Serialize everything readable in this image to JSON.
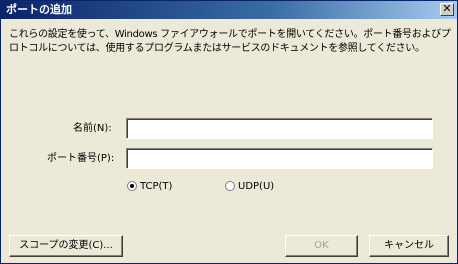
{
  "window": {
    "title": "ポートの追加",
    "close_glyph": "✕"
  },
  "description": {
    "line1": "これらの設定を使って、Windows ファイアウォールでポートを開いてください。ポート番号およびプ",
    "line2": "ロトコルについては、使用するプログラムまたはサービスのドキュメントを参照してください。"
  },
  "form": {
    "name_label": "名前(N):",
    "name_value": "",
    "port_label": "ポート番号(P):",
    "port_value": "",
    "protocol": {
      "tcp_label": "TCP(T)",
      "udp_label": "UDP(U)",
      "selected": "TCP"
    }
  },
  "buttons": {
    "scope_label": "スコープの変更(C)...",
    "ok_label": "OK",
    "cancel_label": "キャンセル"
  }
}
